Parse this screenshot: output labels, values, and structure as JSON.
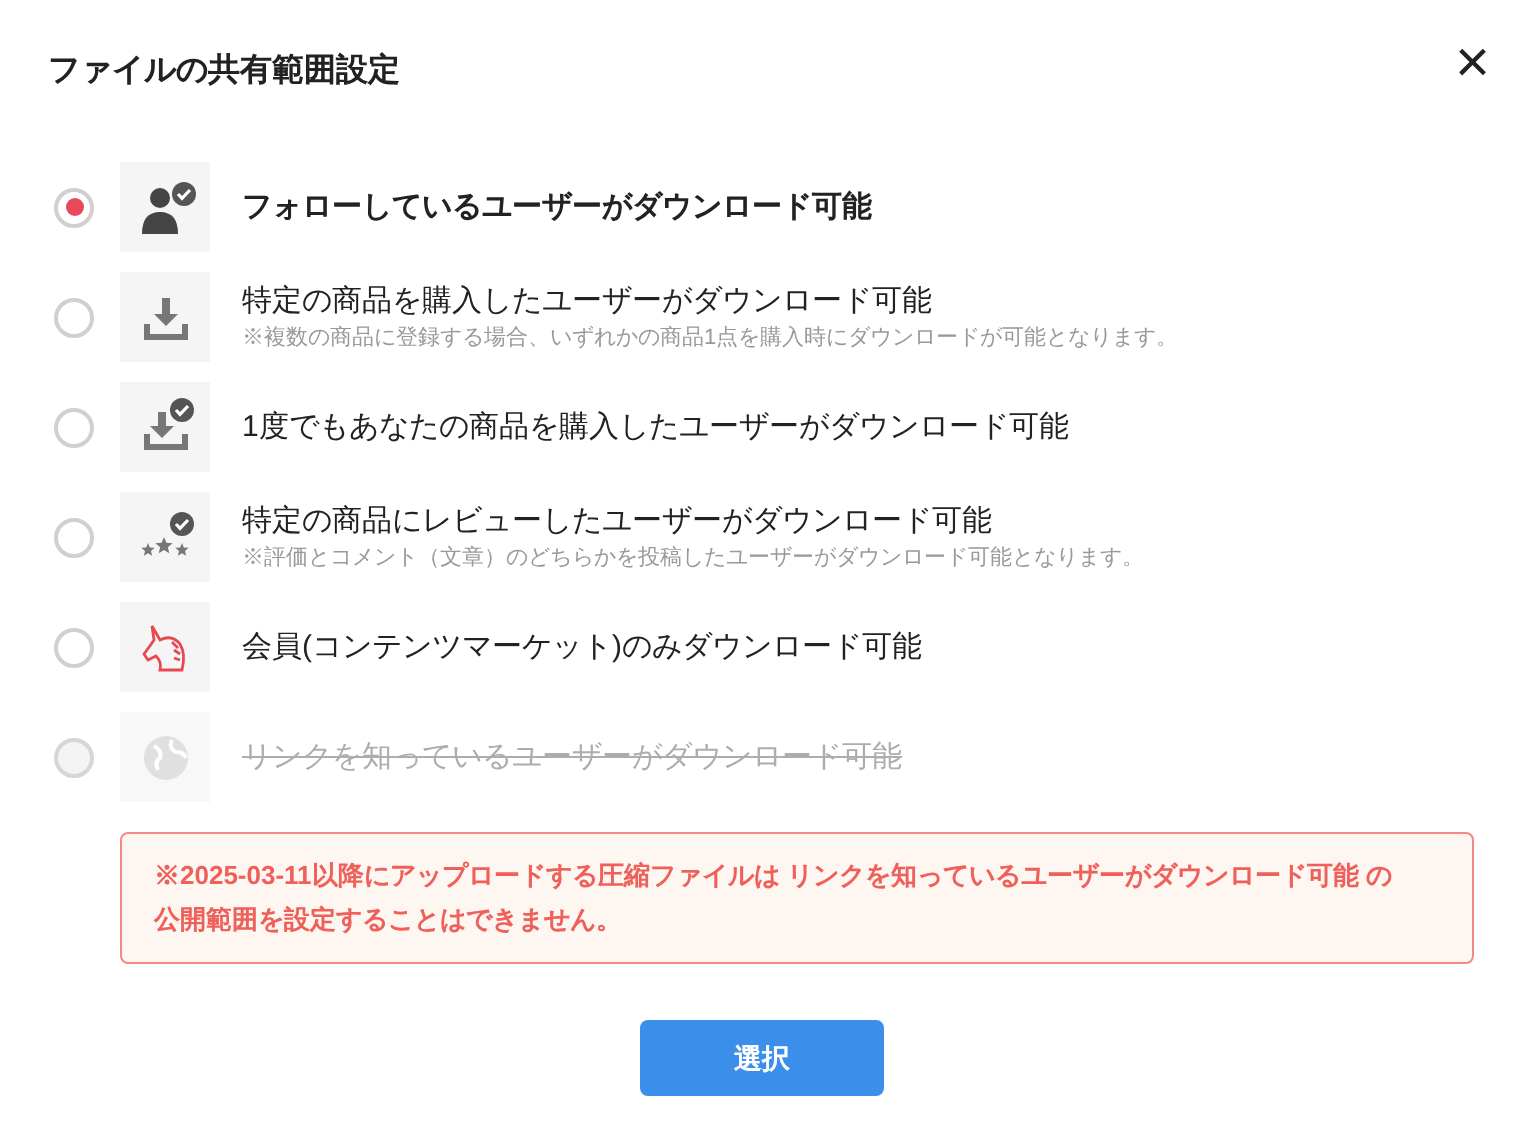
{
  "dialog": {
    "title": "ファイルの共有範囲設定",
    "close_label": "×"
  },
  "options": [
    {
      "kind": "person-check",
      "label": "フォローしているユーザーがダウンロード可能",
      "selected": true,
      "disabled": false
    },
    {
      "kind": "download",
      "label": "特定の商品を購入したユーザーがダウンロード可能",
      "note": "※複数の商品に登録する場合、いずれかの商品1点を購入時にダウンロードが可能となります。",
      "selected": false,
      "disabled": false
    },
    {
      "kind": "download-check",
      "label": "1度でもあなたの商品を購入したユーザーがダウンロード可能",
      "selected": false,
      "disabled": false
    },
    {
      "kind": "stars-check",
      "label": "特定の商品にレビューしたユーザーがダウンロード可能",
      "note": "※評価とコメント（文章）のどちらかを投稿したユーザーがダウンロード可能となります。",
      "selected": false,
      "disabled": false
    },
    {
      "kind": "unicorn",
      "label": "会員(コンテンツマーケット)のみダウンロード可能",
      "selected": false,
      "disabled": false
    },
    {
      "kind": "globe",
      "label": "リンクを知っているユーザーがダウンロード可能",
      "selected": false,
      "disabled": true
    }
  ],
  "notice": {
    "text": "※2025-03-11以降にアップロードする圧縮ファイルは リンクを知っているユーザーがダウンロード可能 の公開範囲を設定することはできません。"
  },
  "button": "選択"
}
